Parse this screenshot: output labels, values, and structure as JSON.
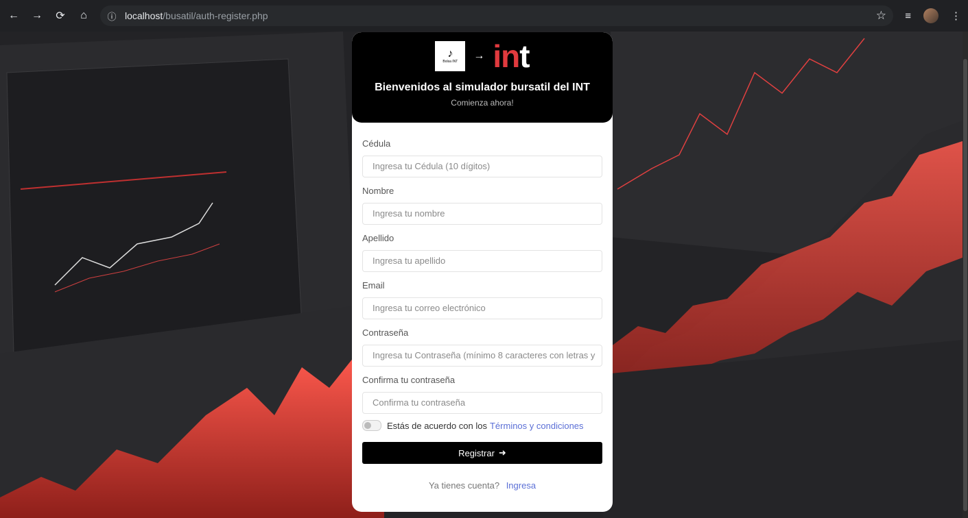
{
  "browser": {
    "url_host": "localhost",
    "url_path": "/busatil/auth-register.php",
    "back_icon": "←",
    "forward_icon": "→",
    "reload_icon": "⟳",
    "home_icon": "⌂",
    "info_icon": "ⓘ",
    "star_icon": "☆",
    "media_icon": "≡",
    "menu_icon": "⋮"
  },
  "header": {
    "logo_text": "Bolsa INT",
    "arrow": "→",
    "int_i": "i",
    "int_n": "n",
    "int_t": "t",
    "title": "Bienvenidos al simulador bursatil del INT",
    "subtitle": "Comienza ahora!"
  },
  "form": {
    "cedula_label": "Cédula",
    "cedula_placeholder": "Ingresa tu Cédula (10 dígitos)",
    "nombre_label": "Nombre",
    "nombre_placeholder": "Ingresa tu nombre",
    "apellido_label": "Apellido",
    "apellido_placeholder": "Ingresa tu apellido",
    "email_label": "Email",
    "email_placeholder": "Ingresa tu correo electrónico",
    "password_label": "Contraseña",
    "password_placeholder": "Ingresa tu Contraseña (mínimo 8 caracteres con letras y",
    "confirm_label": "Confirma tu contraseña",
    "confirm_placeholder": "Confirma tu contraseña",
    "terms_text": "Estás de acuerdo con los",
    "terms_link": "Términos y condiciones",
    "submit_label": "Registrar",
    "submit_icon": "➜"
  },
  "footer": {
    "have_account": "Ya tienes cuenta?",
    "login_link": "Ingresa"
  }
}
